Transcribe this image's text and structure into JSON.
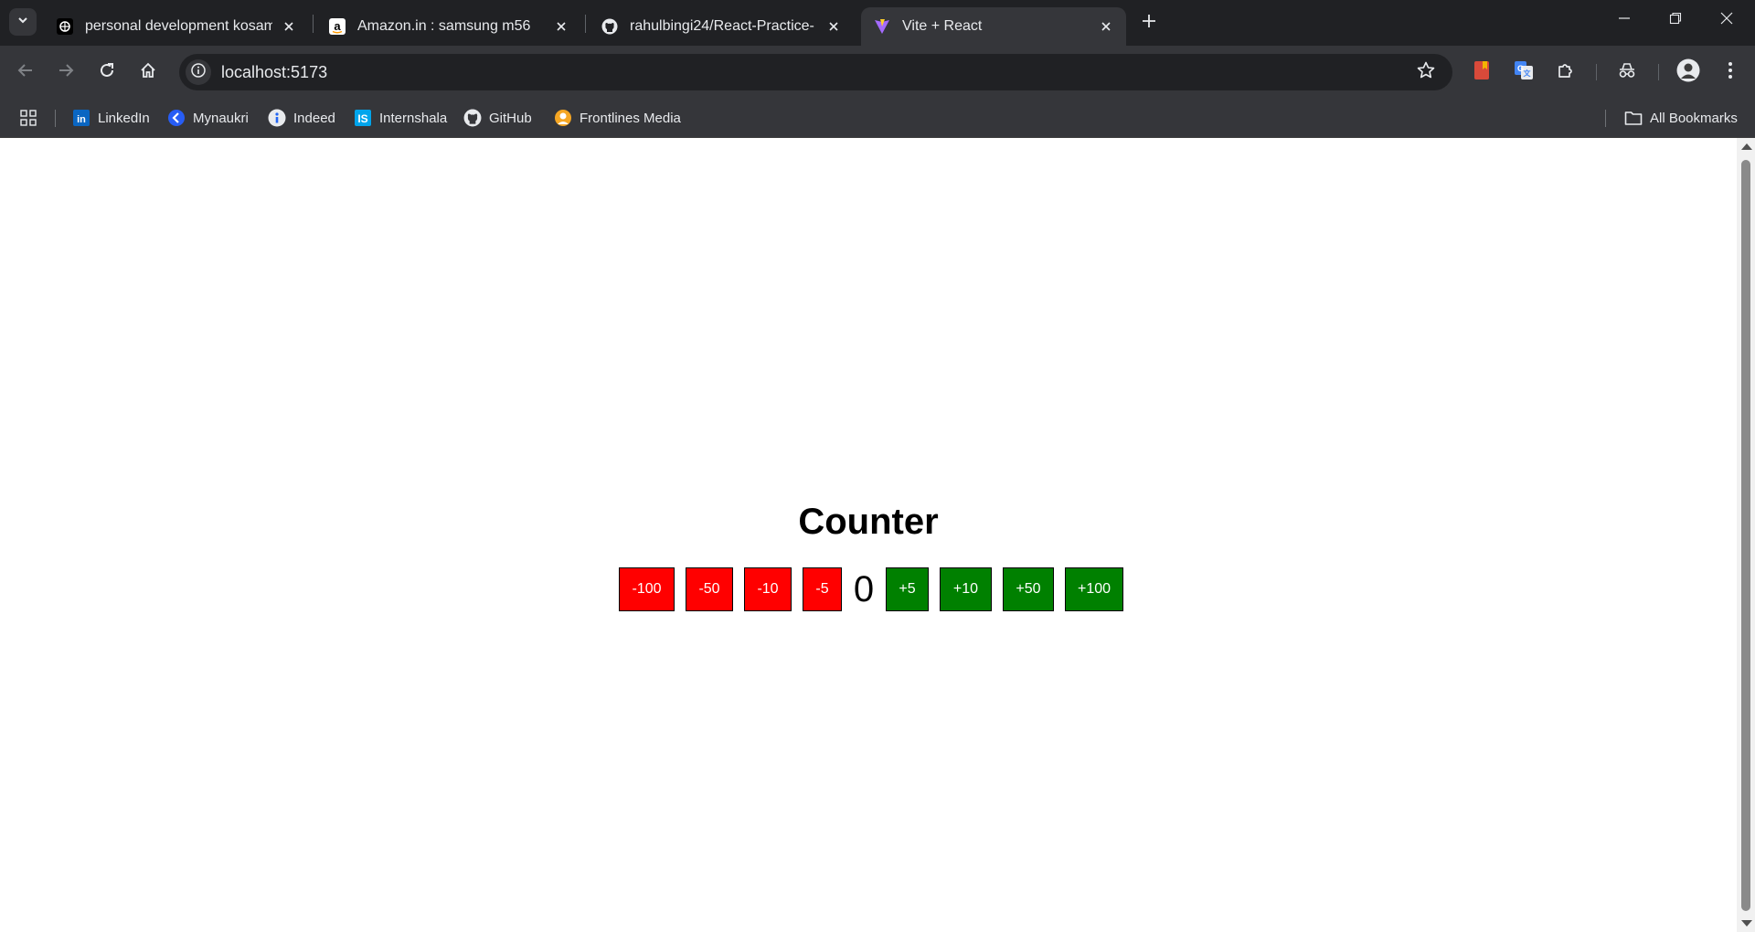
{
  "browser": {
    "tabs": [
      {
        "title": "personal development kosam o",
        "icon": "kosam-favicon",
        "active": false
      },
      {
        "title": "Amazon.in : samsung m56",
        "icon": "amazon-favicon",
        "active": false
      },
      {
        "title": "rahulbingi24/React-Practice-",
        "icon": "github-favicon",
        "active": false
      },
      {
        "title": "Vite + React",
        "icon": "vite-favicon",
        "active": true
      }
    ],
    "url": "localhost:5173",
    "bookmarks": [
      {
        "label": "LinkedIn",
        "icon": "linkedin-icon"
      },
      {
        "label": "Mynaukri",
        "icon": "mynaukri-icon"
      },
      {
        "label": "Indeed",
        "icon": "indeed-icon"
      },
      {
        "label": "Internshala",
        "icon": "internshala-icon"
      },
      {
        "label": "GitHub",
        "icon": "github-icon"
      },
      {
        "label": "Frontlines Media",
        "icon": "frontlines-icon"
      }
    ],
    "all_bookmarks_label": "All Bookmarks"
  },
  "page": {
    "heading": "Counter",
    "value": "0",
    "decrement_buttons": [
      "-100",
      "-50",
      "-10",
      "-5"
    ],
    "increment_buttons": [
      "+5",
      "+10",
      "+50",
      "+100"
    ]
  },
  "colors": {
    "decrement": "#ff0000",
    "increment": "#008000",
    "chrome_dark": "#202124",
    "chrome_toolbar": "#35363a"
  }
}
